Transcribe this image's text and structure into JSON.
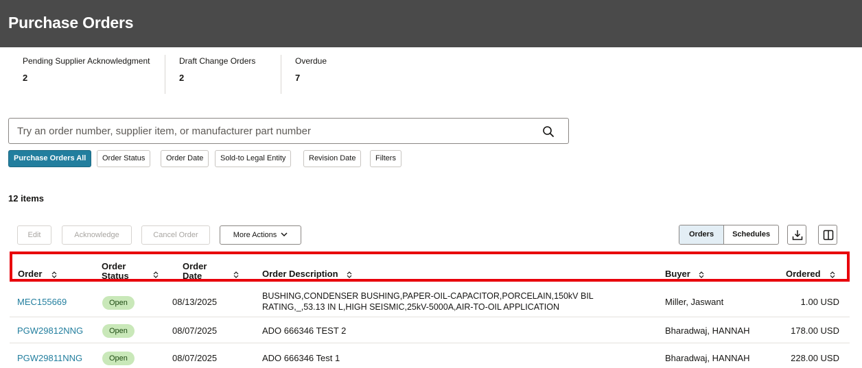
{
  "page": {
    "title": "Purchase Orders"
  },
  "metrics": [
    {
      "label": "Pending Supplier Acknowledgment",
      "value": "2"
    },
    {
      "label": "Draft Change Orders",
      "value": "2"
    },
    {
      "label": "Overdue",
      "value": "7"
    }
  ],
  "search": {
    "placeholder": "Try an order number, supplier item, or manufacturer part number",
    "icon": "search-icon"
  },
  "filters": [
    {
      "label": "Purchase Orders All",
      "active": true
    },
    {
      "label": "Order Status"
    },
    {
      "label": "Order Date"
    },
    {
      "label": "Sold-to Legal Entity"
    },
    {
      "label": "Revision Date"
    },
    {
      "label": "Filters"
    }
  ],
  "items_count": "12 items",
  "toolbar": {
    "edit": "Edit",
    "acknowledge": "Acknowledge",
    "cancel_order": "Cancel Order",
    "more_actions": "More Actions",
    "view_orders": "Orders",
    "view_schedules": "Schedules",
    "download_icon": "download-icon",
    "columns_icon": "columns-icon"
  },
  "table": {
    "columns": {
      "order": "Order",
      "order_status_1": "Order",
      "order_status_2": "Status",
      "order_date_1": "Order",
      "order_date_2": "Date",
      "description": "Order Description",
      "buyer": "Buyer",
      "ordered": "Ordered"
    },
    "rows": [
      {
        "order": "MEC155669",
        "status": "Open",
        "date": "08/13/2025",
        "desc1": "BUSHING,CONDENSER BUSHING,PAPER-OIL-CAPACITOR,PORCELAIN,150kV BIL",
        "desc2": "RATING,_,53.13 IN L,HIGH SEISMIC,25kV-5000A,AIR-TO-OIL APPLICATION",
        "buyer": "Miller, Jaswant",
        "ordered": "1.00 USD"
      },
      {
        "order": "PGW29812NNG",
        "status": "Open",
        "date": "08/07/2025",
        "desc1": "ADO 666346 TEST 2",
        "buyer": "Bharadwaj, HANNAH",
        "ordered": "178.00 USD"
      },
      {
        "order": "PGW29811NNG",
        "status": "Open",
        "date": "08/07/2025",
        "desc1": "ADO 666346 Test 1",
        "buyer": "Bharadwaj, HANNAH",
        "ordered": "228.00 USD"
      }
    ]
  },
  "colors": {
    "header_bg": "#4a4a4a",
    "accent": "#227e9e",
    "highlight": "#e8000b",
    "open_badge": "#c9e8b9"
  }
}
